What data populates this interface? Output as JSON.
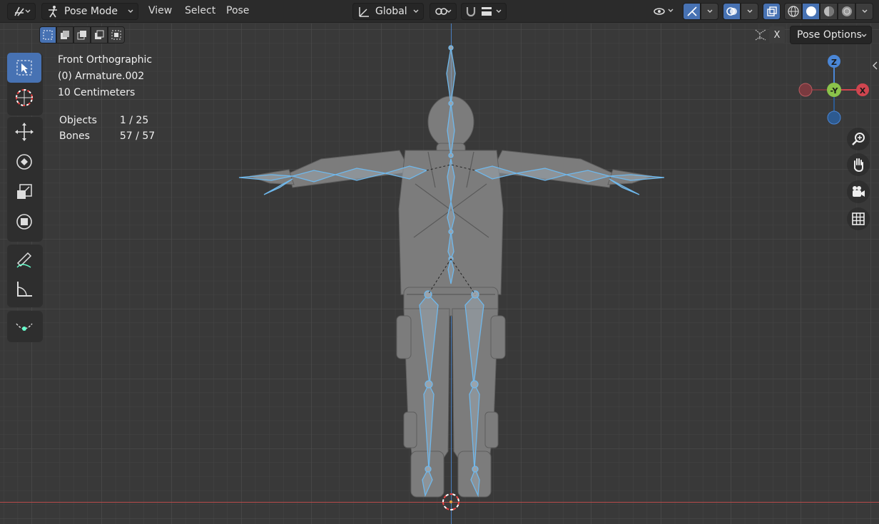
{
  "header": {
    "mode_label": "Pose Mode",
    "menus": [
      "View",
      "Select",
      "Pose"
    ],
    "transform_orientation": "Global"
  },
  "tool_settings": {
    "x_label": "X",
    "options_label": "Pose Options"
  },
  "overlay": {
    "view_name": "Front Orthographic",
    "object_name": "(0) Armature.002",
    "grid_scale": "10 Centimeters",
    "stats": [
      {
        "label": "Objects",
        "value": "1 / 25"
      },
      {
        "label": "Bones",
        "value": "57 / 57"
      }
    ]
  },
  "gizmo": {
    "z": "Z",
    "y": "-Y",
    "x": "X"
  },
  "colors": {
    "accent": "#4772b3",
    "bone_outline": "#6fb8ec",
    "axis_x": "#b84a4a",
    "axis_z": "#4a7fc0",
    "gizmo_x": "#d0454f",
    "gizmo_y": "#8bc34a",
    "gizmo_z": "#4a86d6"
  }
}
